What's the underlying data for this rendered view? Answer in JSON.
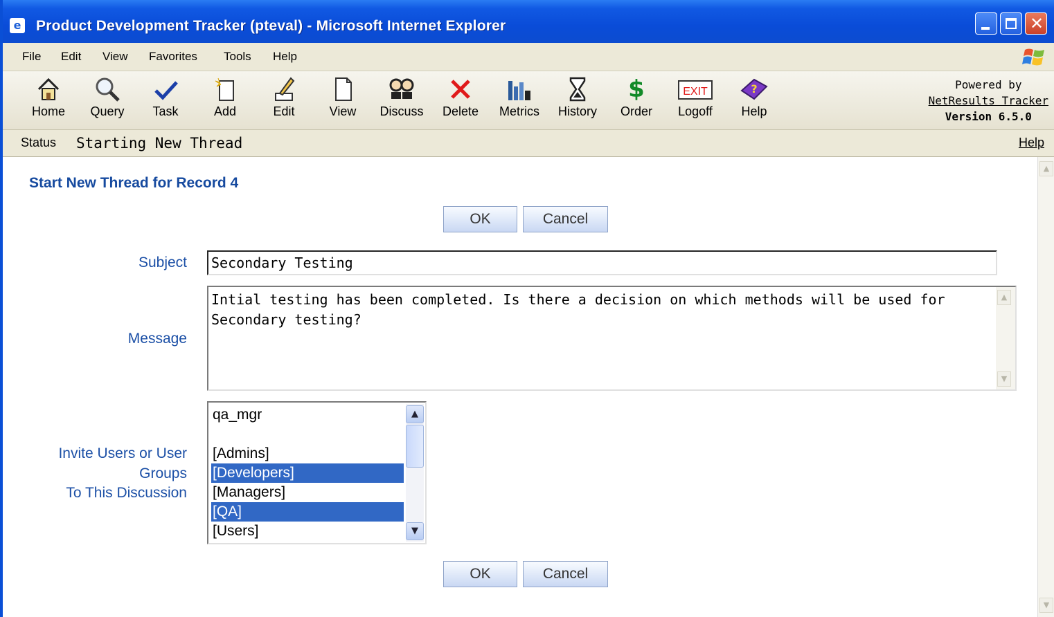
{
  "window": {
    "title": "Product Development Tracker (pteval) - Microsoft Internet Explorer"
  },
  "menu": {
    "items": [
      "File",
      "Edit",
      "View",
      "Favorites",
      "Tools",
      "Help"
    ]
  },
  "toolbar": {
    "buttons": [
      {
        "label": "Home",
        "icon": "home-icon"
      },
      {
        "label": "Query",
        "icon": "magnifier-icon"
      },
      {
        "label": "Task",
        "icon": "checkmark-icon"
      },
      {
        "label": "Add",
        "icon": "new-document-icon"
      },
      {
        "label": "Edit",
        "icon": "pencil-icon"
      },
      {
        "label": "View",
        "icon": "document-icon"
      },
      {
        "label": "Discuss",
        "icon": "people-icon"
      },
      {
        "label": "Delete",
        "icon": "red-x-icon"
      },
      {
        "label": "Metrics",
        "icon": "bar-chart-icon"
      },
      {
        "label": "History",
        "icon": "hourglass-icon"
      },
      {
        "label": "Order",
        "icon": "dollar-icon"
      },
      {
        "label": "Logoff",
        "icon": "exit-sign-icon"
      },
      {
        "label": "Help",
        "icon": "help-book-icon"
      }
    ],
    "powered_by": {
      "line1": "Powered by",
      "link": "NetResults Tracker",
      "version": "Version 6.5.0"
    }
  },
  "status": {
    "label": "Status",
    "text": "Starting New Thread",
    "help": "Help"
  },
  "form": {
    "heading": "Start New Thread for Record 4",
    "ok_label": "OK",
    "cancel_label": "Cancel",
    "subject_label": "Subject",
    "subject_value": "Secondary Testing",
    "message_label": "Message",
    "message_value": "Intial testing has been completed. Is there a decision on which methods will be used for Secondary testing?",
    "invite_label_1": "Invite Users or User",
    "invite_label_2": "Groups",
    "invite_label_3": "To This Discussion",
    "invite_options": [
      {
        "text": "qa_mgr",
        "selected": false
      },
      {
        "text": "",
        "selected": false
      },
      {
        "text": "[Admins]",
        "selected": false
      },
      {
        "text": "[Developers]",
        "selected": true
      },
      {
        "text": "[Managers]",
        "selected": false
      },
      {
        "text": "[QA]",
        "selected": true
      },
      {
        "text": "[Users]",
        "selected": false
      }
    ]
  },
  "colors": {
    "title_bar": "#0a4cd8",
    "label_blue": "#1b4fa6",
    "selection": "#3168c5"
  }
}
